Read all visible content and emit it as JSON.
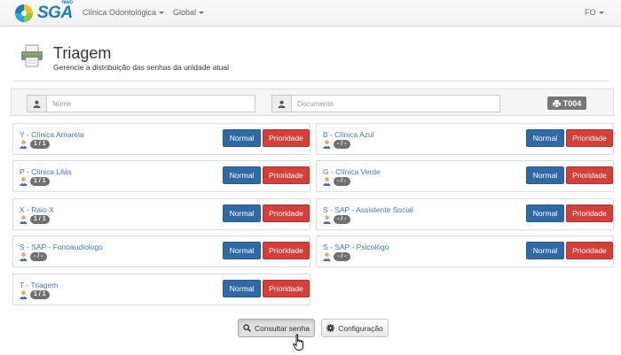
{
  "brand": {
    "name": "SGA",
    "tag": "novo"
  },
  "nav": {
    "left": [
      {
        "label": "Clínica Odontológica"
      },
      {
        "label": "Global"
      }
    ],
    "user": "FO"
  },
  "header": {
    "title": "Triagem",
    "subtitle": "Gerencie a distribuição das senhas da unidade atual"
  },
  "search": {
    "name_placeholder": "Nome",
    "document_placeholder": "Documento",
    "ticket_label": "T004"
  },
  "buttons": {
    "normal": "Normal",
    "priority": "Prioridade"
  },
  "services": [
    {
      "name": "Y - Clínica Amarela",
      "count": "1 / 1"
    },
    {
      "name": "B - Clínica Azul",
      "count": "- / -"
    },
    {
      "name": "P - Clínica Lilás",
      "count": "1 / 1"
    },
    {
      "name": "G - Clínica Verde",
      "count": "- / -"
    },
    {
      "name": "X - Raio X",
      "count": "1 / 1"
    },
    {
      "name": "S - SAP - Assistente Social",
      "count": "- / -"
    },
    {
      "name": "S - SAP - Fonoaudiologo",
      "count": "- / -"
    },
    {
      "name": "S - SAP - Psicológo",
      "count": "- / -"
    },
    {
      "name": "T - Triagem",
      "count": "1 / 1"
    }
  ],
  "footer": {
    "consult_label": "Consultar senha",
    "config_label": "Configuração"
  },
  "colors": {
    "primary": "#2f6aa6",
    "danger": "#d43f3a",
    "link": "#3f7ab5",
    "badge": "#6f6f6f"
  }
}
